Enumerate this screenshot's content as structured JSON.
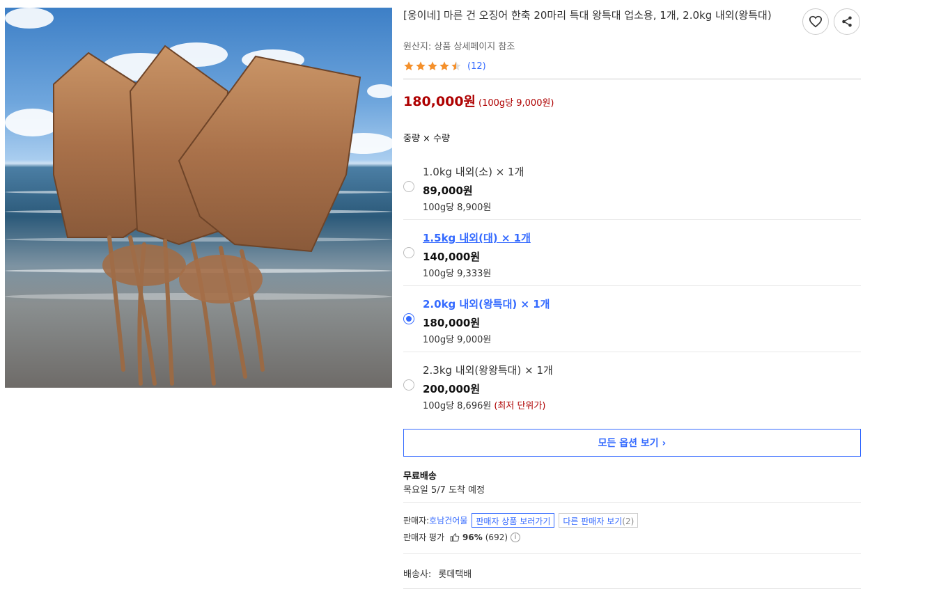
{
  "product": {
    "title": "[웅이네] 마른 건 오징어 한축 20마리 특대 왕특대 업소용, 1개, 2.0kg 내외(왕특대)",
    "origin": "원산지: 상품 상세페이지 참조",
    "rating_value": 4.5,
    "review_count": "(12)",
    "price": "180,000원",
    "unit_price": "(100g당 9,000원)"
  },
  "options": {
    "header": "중량 × 수량",
    "items": [
      {
        "name": "1.0kg 내외(소) × 1개",
        "price": "89,000원",
        "unit": "100g당 8,900원",
        "note": "",
        "state": "normal"
      },
      {
        "name": "1.5kg 내외(대) × 1개",
        "price": "140,000원",
        "unit": "100g당 9,333원",
        "note": "",
        "state": "linked"
      },
      {
        "name": "2.0kg 내외(왕특대) × 1개",
        "price": "180,000원",
        "unit": "100g당 9,000원",
        "note": "",
        "state": "selected"
      },
      {
        "name": "2.3kg 내외(왕왕특대) × 1개",
        "price": "200,000원",
        "unit": "100g당 8,696원",
        "note": "(최저 단위가)",
        "state": "normal"
      }
    ],
    "all_options_label": "모든 옵션 보기 ›"
  },
  "shipping": {
    "title": "무료배송",
    "date": "목요일 5/7 도착 예정"
  },
  "seller": {
    "label": "판매자: ",
    "name": "호남건어물",
    "view_products": "판매자 상품 보러가기",
    "other_sellers": "다른 판매자 보기",
    "other_count": "(2)",
    "rating_label": "판매자 평가",
    "rating_pct": "96%",
    "rating_count": "(692)"
  },
  "carrier": {
    "label": "배송사:",
    "name": "롯데택배"
  },
  "colors": {
    "accent": "#346aff",
    "price": "#ae0000",
    "star": "#f5902a"
  },
  "icons": [
    "heart-icon",
    "share-icon",
    "star-icon",
    "thumbs-up-icon",
    "info-icon"
  ]
}
